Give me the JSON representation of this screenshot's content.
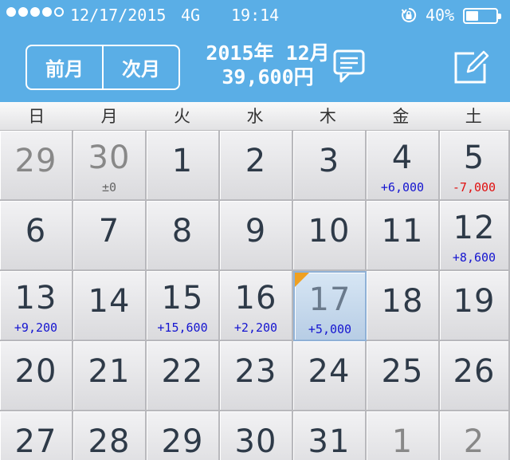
{
  "status_bar": {
    "signal_dots": [
      true,
      true,
      true,
      true,
      false
    ],
    "date": "12/17/2015",
    "network": "4G",
    "time": "19:14",
    "battery_pct": "40%",
    "battery_level": 0.4
  },
  "header": {
    "prev_label": "前月",
    "next_label": "次月",
    "month": "2015年 12月",
    "total": "39,600円",
    "bg_color": "#5aaee6"
  },
  "weekdays": [
    "日",
    "月",
    "火",
    "水",
    "木",
    "金",
    "土"
  ],
  "days": [
    {
      "n": "29",
      "muted": true,
      "amt": "",
      "kind": ""
    },
    {
      "n": "30",
      "muted": true,
      "amt": "±0",
      "kind": "zero"
    },
    {
      "n": "1",
      "muted": false,
      "amt": "",
      "kind": ""
    },
    {
      "n": "2",
      "muted": false,
      "amt": "",
      "kind": ""
    },
    {
      "n": "3",
      "muted": false,
      "amt": "",
      "kind": ""
    },
    {
      "n": "4",
      "muted": false,
      "amt": "+6,000",
      "kind": "pos"
    },
    {
      "n": "5",
      "muted": false,
      "amt": "-7,000",
      "kind": "neg"
    },
    {
      "n": "6",
      "muted": false,
      "amt": "",
      "kind": ""
    },
    {
      "n": "7",
      "muted": false,
      "amt": "",
      "kind": ""
    },
    {
      "n": "8",
      "muted": false,
      "amt": "",
      "kind": ""
    },
    {
      "n": "9",
      "muted": false,
      "amt": "",
      "kind": ""
    },
    {
      "n": "10",
      "muted": false,
      "amt": "",
      "kind": ""
    },
    {
      "n": "11",
      "muted": false,
      "amt": "",
      "kind": ""
    },
    {
      "n": "12",
      "muted": false,
      "amt": "+8,600",
      "kind": "pos"
    },
    {
      "n": "13",
      "muted": false,
      "amt": "+9,200",
      "kind": "pos"
    },
    {
      "n": "14",
      "muted": false,
      "amt": "",
      "kind": ""
    },
    {
      "n": "15",
      "muted": false,
      "amt": "+15,600",
      "kind": "pos"
    },
    {
      "n": "16",
      "muted": false,
      "amt": "+2,200",
      "kind": "pos"
    },
    {
      "n": "17",
      "muted": false,
      "amt": "+5,000",
      "kind": "pos",
      "today": true
    },
    {
      "n": "18",
      "muted": false,
      "amt": "",
      "kind": ""
    },
    {
      "n": "19",
      "muted": false,
      "amt": "",
      "kind": ""
    },
    {
      "n": "20",
      "muted": false,
      "amt": "",
      "kind": ""
    },
    {
      "n": "21",
      "muted": false,
      "amt": "",
      "kind": ""
    },
    {
      "n": "22",
      "muted": false,
      "amt": "",
      "kind": ""
    },
    {
      "n": "23",
      "muted": false,
      "amt": "",
      "kind": ""
    },
    {
      "n": "24",
      "muted": false,
      "amt": "",
      "kind": ""
    },
    {
      "n": "25",
      "muted": false,
      "amt": "",
      "kind": ""
    },
    {
      "n": "26",
      "muted": false,
      "amt": "",
      "kind": ""
    },
    {
      "n": "27",
      "muted": false,
      "amt": "",
      "kind": ""
    },
    {
      "n": "28",
      "muted": false,
      "amt": "",
      "kind": ""
    },
    {
      "n": "29",
      "muted": false,
      "amt": "",
      "kind": ""
    },
    {
      "n": "30",
      "muted": false,
      "amt": "",
      "kind": ""
    },
    {
      "n": "31",
      "muted": false,
      "amt": "",
      "kind": ""
    },
    {
      "n": "1",
      "muted": true,
      "amt": "",
      "kind": ""
    },
    {
      "n": "2",
      "muted": true,
      "amt": "",
      "kind": ""
    }
  ],
  "icons": {
    "comment": "speech-bubble-icon",
    "edit": "pencil-edit-icon",
    "lock": "rotation-lock-icon"
  }
}
